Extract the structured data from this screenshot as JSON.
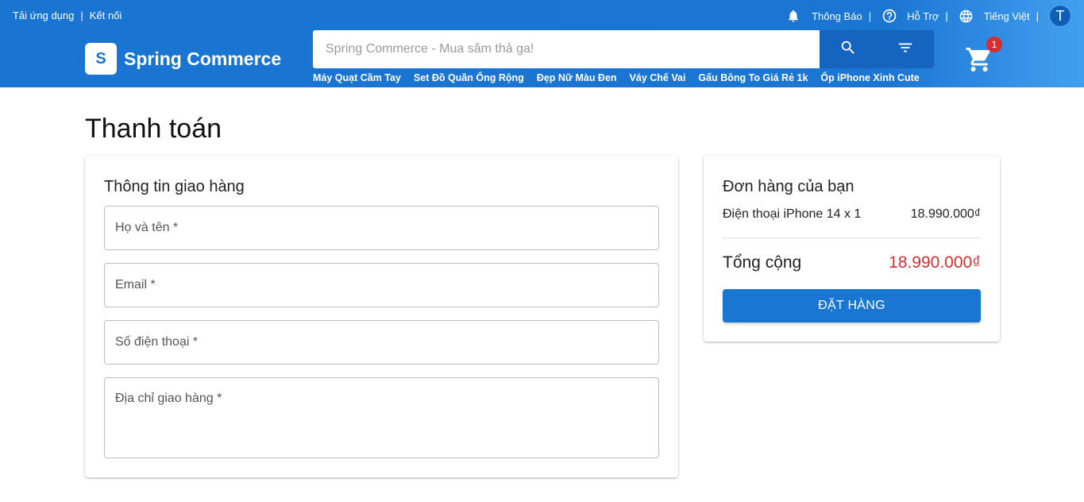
{
  "topbar": {
    "left_links": [
      "Tải ứng dụng",
      "Kết nối"
    ],
    "separator": "|",
    "notifications_label": "Thông Báo",
    "support_label": "Hỗ Trợ",
    "language_label": "Tiếng Việt",
    "avatar_letter": "T"
  },
  "brand": {
    "logo_letter": "S",
    "name": "Spring Commerce"
  },
  "search": {
    "placeholder": "Spring Commerce - Mua sắm thả ga!",
    "value": ""
  },
  "cart": {
    "count": "1"
  },
  "quick_links": [
    "Máy Quạt Cầm Tay",
    "Set Đồ Quần Ống Rộng",
    "Đẹp Nữ Màu Đen",
    "Váy Chế Vai",
    "Gấu Bông To Giá Rẻ 1k",
    "Ốp iPhone Xinh Cute"
  ],
  "page": {
    "title": "Thanh toán"
  },
  "shipping": {
    "title": "Thông tin giao hàng",
    "fields": [
      {
        "placeholder": "Họ và tên *",
        "value": ""
      },
      {
        "placeholder": "Email *",
        "value": ""
      },
      {
        "placeholder": "Số điện thoại *",
        "value": ""
      },
      {
        "placeholder": "Địa chỉ giao hàng *",
        "value": ""
      }
    ]
  },
  "order": {
    "title": "Đơn hàng của bạn",
    "item_name": "Điện thoại iPhone 14 x 1",
    "item_price": "18.990.000₫",
    "total_label": "Tổng cộng",
    "total_value": "18.990.000₫",
    "submit_label": "ĐẶT HÀNG"
  },
  "icons": {
    "notification": "bell-icon",
    "support": "help-circle-icon",
    "language": "globe-icon",
    "search": "search-icon",
    "filter": "filter-icon",
    "cart": "shopping-cart-icon"
  },
  "colors": {
    "primary": "#1a74d2",
    "accent_dark": "#1565c0",
    "badge": "#d32f2f",
    "total": "#d32f2f"
  }
}
